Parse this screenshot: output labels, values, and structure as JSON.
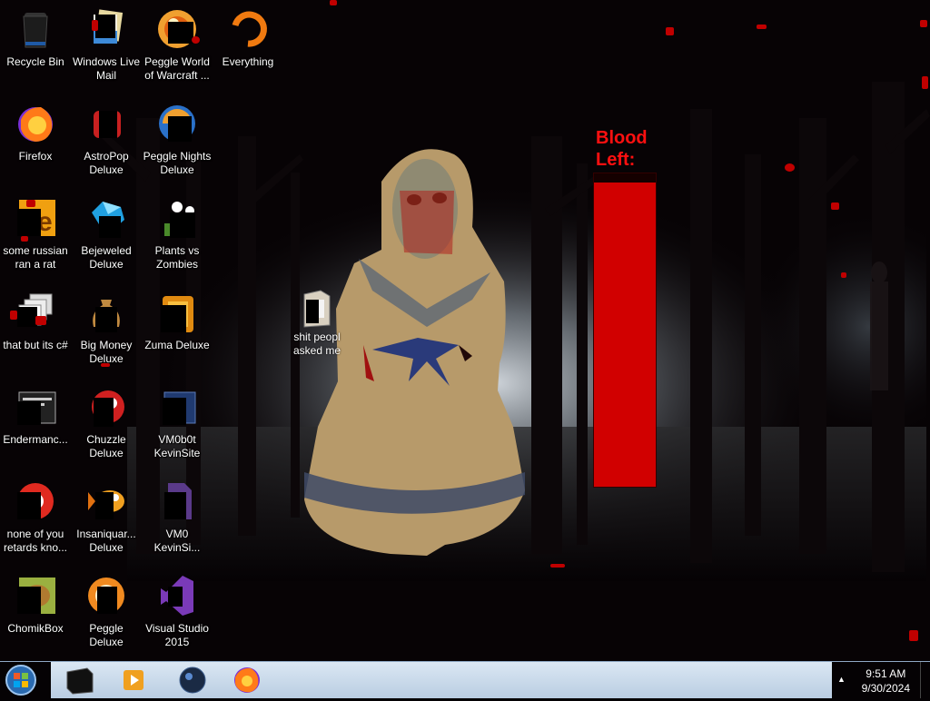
{
  "desktop": {
    "icons": [
      {
        "name": "recycle-bin",
        "label": "Recycle Bin",
        "icon": "trash-can-icon"
      },
      {
        "name": "windows-live-mail",
        "label": "Windows Live\nMail",
        "icon": "mail-icon"
      },
      {
        "name": "peggle-world-of-warcraft",
        "label": "Peggle World\nof Warcraft ...",
        "icon": "peggle-icon"
      },
      {
        "name": "everything",
        "label": "Everything",
        "icon": "search-icon"
      },
      {
        "name": "firefox",
        "label": "Firefox",
        "icon": "firefox-icon"
      },
      {
        "name": "astropop-deluxe",
        "label": "AstroPop\nDeluxe",
        "icon": "astropop-icon"
      },
      {
        "name": "peggle-nights-deluxe",
        "label": "Peggle Nights\nDeluxe",
        "icon": "peggle-icon"
      },
      {
        "name": "some-russian-ran-a-rat",
        "label": "some russian\nran a rat",
        "icon": "ie-icon"
      },
      {
        "name": "bejeweled-deluxe",
        "label": "Bejeweled\nDeluxe",
        "icon": "gem-icon"
      },
      {
        "name": "plants-vs-zombies",
        "label": "Plants vs\nZombies",
        "icon": "plant-icon"
      },
      {
        "name": "that-but-its-csharp",
        "label": "that but its c#",
        "icon": "windows-stack-icon"
      },
      {
        "name": "big-money-deluxe",
        "label": "Big Money\nDeluxe",
        "icon": "money-bag-icon"
      },
      {
        "name": "zuma-deluxe",
        "label": "Zuma Deluxe",
        "icon": "frog-idol-icon"
      },
      {
        "name": "endermanch",
        "label": "Endermanc...",
        "icon": "terminal-icon"
      },
      {
        "name": "chuzzle-deluxe",
        "label": "Chuzzle\nDeluxe",
        "icon": "chuzzle-icon"
      },
      {
        "name": "vm0b0t-kevinsite",
        "label": "VM0b0t\nKevinSite",
        "icon": "shortcut-icon"
      },
      {
        "name": "none-of-you-retards-know",
        "label": "none of you\nretards kno...",
        "icon": "chrome-icon"
      },
      {
        "name": "insaniquarium-deluxe",
        "label": "Insaniquar...\nDeluxe",
        "icon": "fish-icon"
      },
      {
        "name": "vm0-kevinsite",
        "label": "VM0\nKevinSi...",
        "icon": "file-icon"
      },
      {
        "name": "chomikbox",
        "label": "ChomikBox",
        "icon": "hamster-icon"
      },
      {
        "name": "peggle-deluxe",
        "label": "Peggle Deluxe",
        "icon": "peggle-icon"
      },
      {
        "name": "visual-studio-2015",
        "label": "Visual Studio\n2015",
        "icon": "visual-studio-icon"
      }
    ],
    "folder": {
      "label": "shit peopl\nasked me",
      "icon": "folder-icon"
    }
  },
  "blood_meter": {
    "title": "Blood\nLeft:",
    "level": 0.97,
    "color": "#d10000"
  },
  "taskbar": {
    "pinned": [
      {
        "name": "taskbar-app-1",
        "icon": "black-cube-icon"
      },
      {
        "name": "taskbar-media-player",
        "icon": "media-player-icon"
      },
      {
        "name": "taskbar-app-3",
        "icon": "dark-orb-icon"
      },
      {
        "name": "taskbar-firefox",
        "icon": "firefox-icon"
      }
    ],
    "clock": {
      "time": "9:51 AM",
      "date": "9/30/2024"
    }
  },
  "colors": {
    "accent": "#d10000",
    "taskbar": "#c9dbec"
  }
}
